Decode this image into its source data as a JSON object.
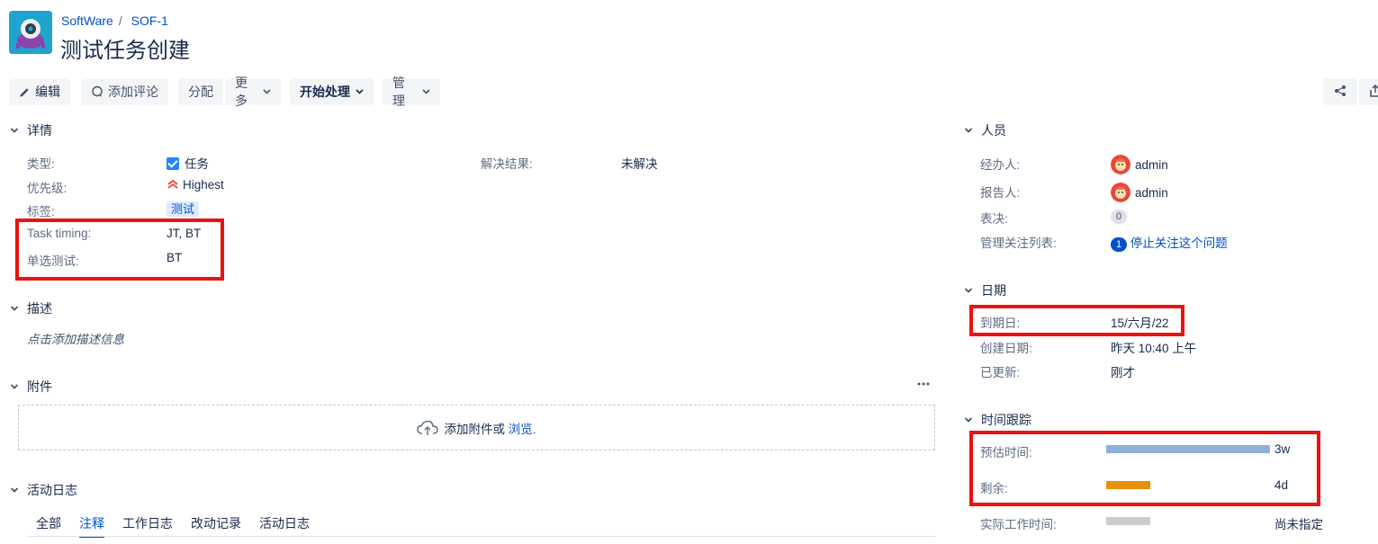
{
  "header": {
    "breadcrumb": [
      "SoftWare",
      "SOF-1"
    ],
    "separator": "/",
    "title": "测试任务创建"
  },
  "toolbar": {
    "edit": "编辑",
    "comment": "添加评论",
    "assign": "分配",
    "more": "更多",
    "start": "开始处理",
    "admin": "管理"
  },
  "details": {
    "heading": "详情",
    "fields": [
      {
        "label": "类型:",
        "value": "任务"
      },
      {
        "label": "优先级:",
        "value": "Highest"
      },
      {
        "label": "标签:",
        "value": "测试"
      },
      {
        "label": "Task timing:",
        "value": "JT, BT"
      },
      {
        "label": "单选测试:",
        "value": "BT"
      }
    ],
    "resolution": {
      "label": "解决结果:",
      "value": "未解决"
    }
  },
  "description": {
    "heading": "描述",
    "placeholder": "点击添加描述信息"
  },
  "attachments": {
    "heading": "附件",
    "drop_text": "添加附件或",
    "browse": "浏览."
  },
  "activity": {
    "heading": "活动日志",
    "tabs": [
      "全部",
      "注释",
      "工作日志",
      "改动记录",
      "活动日志"
    ],
    "active_tab": "注释"
  },
  "people": {
    "heading": "人员",
    "assignee": {
      "label": "经办人:",
      "value": "admin"
    },
    "reporter": {
      "label": "报告人:",
      "value": "admin"
    },
    "votes": {
      "label": "表决:",
      "value": "0"
    },
    "watchers": {
      "label": "管理关注列表:",
      "count": "1",
      "action": "停止关注这个问题"
    }
  },
  "dates": {
    "heading": "日期",
    "due": {
      "label": "到期日:",
      "value": "15/六月/22"
    },
    "created": {
      "label": "创建日期:",
      "value": "昨天 10:40 上午"
    },
    "updated": {
      "label": "已更新:",
      "value": "刚才"
    }
  },
  "time_tracking": {
    "heading": "时间跟踪",
    "estimated": {
      "label": "预估时间:",
      "value": "3w",
      "fill": 1.0,
      "color": "#8eb0d8"
    },
    "remaining": {
      "label": "剩余:",
      "value": "4d",
      "fill": 0.27,
      "color": "#e8910c"
    },
    "logged": {
      "label": "实际工作时间:",
      "value": "尚未指定",
      "fill": 0.27,
      "color": "#cccccc"
    }
  },
  "colors": {
    "accent": "#0052cc",
    "highlight": "#ee1111",
    "priority": "#e5493a"
  }
}
